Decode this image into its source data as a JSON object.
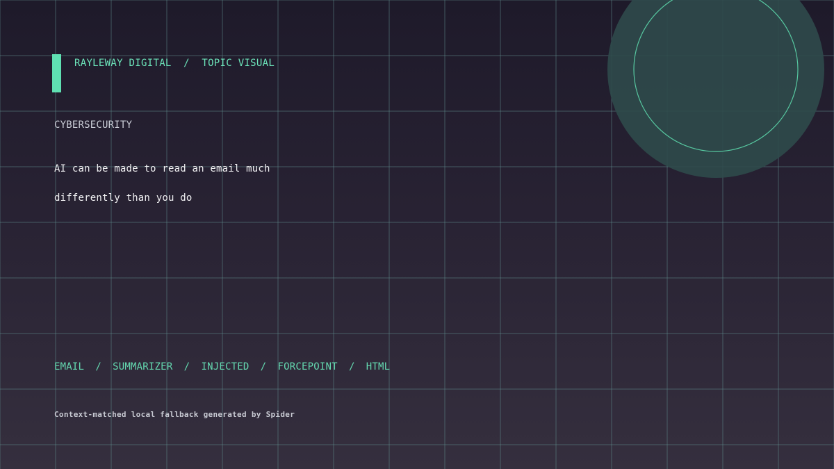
{
  "header": {
    "brand": "RAYLEWAY DIGITAL",
    "separator": "/",
    "section": "TOPIC VISUAL"
  },
  "category": "CYBERSECURITY",
  "headline": {
    "line1": "AI can be made to read an email much",
    "line2": "differently than you do"
  },
  "tags": {
    "items": [
      "EMAIL",
      "SUMMARIZER",
      "INJECTED",
      "FORCEPOINT",
      "HTML"
    ],
    "separator": "/"
  },
  "footer": {
    "text": "Context-matched local fallback generated by Spider"
  },
  "colors": {
    "accent": "#5fe0b2",
    "background_top": "#1e1a2a",
    "background_bottom": "#352f3e",
    "grid": "#5f8b8c",
    "orb_fill": "#2f4a4b"
  },
  "icons": {
    "orb": "circle-orb-icon",
    "accent": "vertical-accent-bar"
  }
}
